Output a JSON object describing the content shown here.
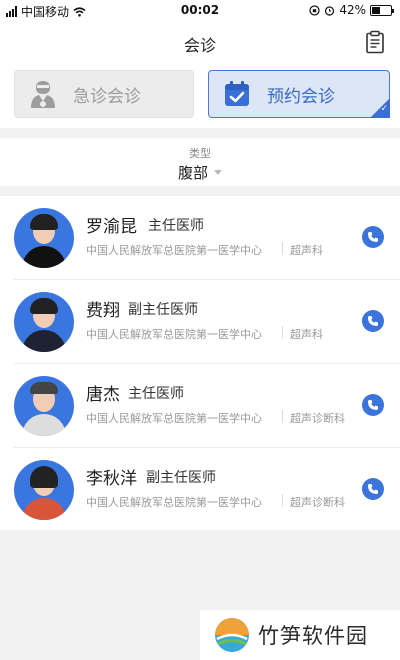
{
  "status_bar": {
    "carrier": "中国移动",
    "time": "00:02",
    "battery": "42%"
  },
  "header": {
    "title": "会诊",
    "right_icon": "clipboard-icon"
  },
  "mode_toggle": {
    "emergency_label": "急诊会诊",
    "appointment_label": "预约会诊",
    "selected": "appointment",
    "accent_color": "#3a6fd6"
  },
  "type_filter": {
    "caption": "类型",
    "value": "腹部"
  },
  "doctors": [
    {
      "name": "罗渝昆",
      "title": "主任医师",
      "hospital": "中国人民解放军总医院第一医学中心",
      "department": "超声科"
    },
    {
      "name": "费翔",
      "title": "副主任医师",
      "hospital": "中国人民解放军总医院第一医学中心",
      "department": "超声科"
    },
    {
      "name": "唐杰",
      "title": "主任医师",
      "hospital": "中国人民解放军总医院第一医学中心",
      "department": "超声诊断科"
    },
    {
      "name": "李秋洋",
      "title": "副主任医师",
      "hospital": "中国人民解放军总医院第一医学中心",
      "department": "超声诊断科"
    }
  ],
  "watermark": {
    "text": "竹笋软件园"
  }
}
